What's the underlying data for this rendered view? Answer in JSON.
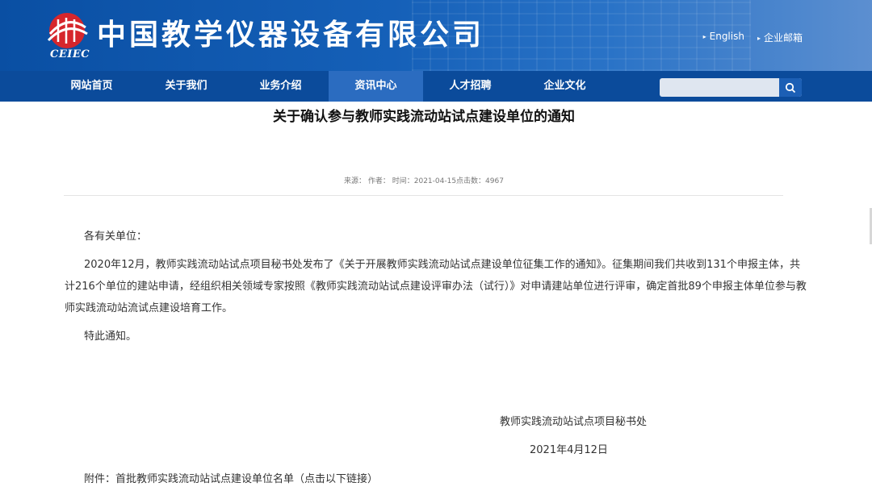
{
  "header": {
    "company_name": "中国教学仪器设备有限公司",
    "logo_text": "CEIEC",
    "links": [
      {
        "label": "English"
      },
      {
        "label": "企业邮箱"
      }
    ]
  },
  "nav": {
    "items": [
      {
        "label": "网站首页"
      },
      {
        "label": "关于我们"
      },
      {
        "label": "业务介绍"
      },
      {
        "label": "资讯中心"
      },
      {
        "label": "人才招聘"
      },
      {
        "label": "企业文化"
      }
    ],
    "active_index": 3,
    "search": {
      "value": "",
      "placeholder": ""
    }
  },
  "article": {
    "title": "关于确认参与教师实践流动站试点建设单位的通知",
    "meta": "来源： 作者： 时间：2021-04-15点击数：4967",
    "salutation": "各有关单位：",
    "body_lines": [
      "2020年12月，教师实践流动站试点项目秘书处发布了《关于开展教师实践流动站试点建设单位征集工作的通知》。征集期间我们共收到131个申报主体，共",
      "计216个单位的建站申请，经组织相关领域专家按照《教师实践流动站试点建设评审办法（试行）》对申请建站单位进行评审，确定首批89个申报主体单位参与教",
      "师实践流动站流试点建设培育工作。"
    ],
    "closing": "特此通知。",
    "signature": "教师实践流动站试点项目秘书处",
    "date": "2021年4月12日",
    "attachment": "附件：首批教师实践流动站试点建设单位名单（点击以下链接）"
  },
  "colors": {
    "nav_bg": "#0b4b9b",
    "nav_active": "#2b6cc0",
    "header_blue": "#1560b8",
    "logo_red": "#d6262c"
  }
}
